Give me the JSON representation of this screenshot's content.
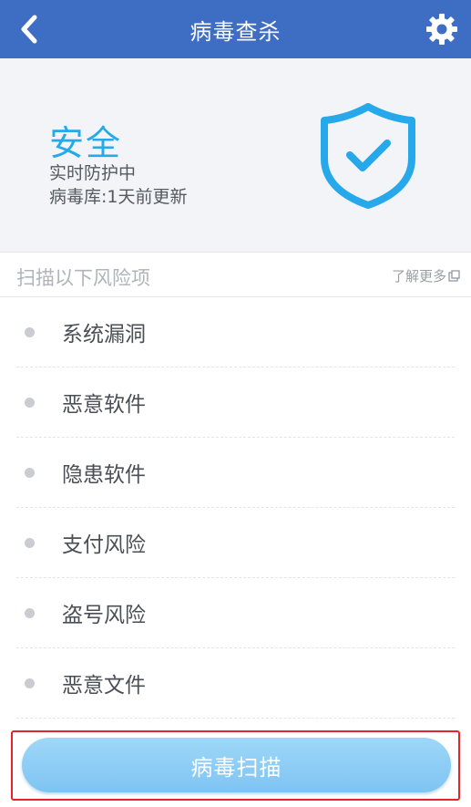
{
  "header": {
    "title": "病毒查杀",
    "back_icon": "chevron-left-icon",
    "settings_icon": "gear-icon",
    "bg_color": "#3e6ec3"
  },
  "status": {
    "headline": "安全",
    "realtime": "实时防护中",
    "db_update": "病毒库:1天前更新",
    "shield_icon": "shield-check-icon",
    "accent_color": "#26a9e9"
  },
  "section": {
    "title": "扫描以下风险项",
    "more_label": "了解更多",
    "more_icon": "external-link-icon"
  },
  "risk_items": [
    {
      "label": "系统漏洞"
    },
    {
      "label": "恶意软件"
    },
    {
      "label": "隐患软件"
    },
    {
      "label": "支付风险"
    },
    {
      "label": "盗号风险"
    },
    {
      "label": "恶意文件"
    }
  ],
  "scan_button": {
    "label": "病毒扫描",
    "highlight_color": "#e0262b"
  }
}
